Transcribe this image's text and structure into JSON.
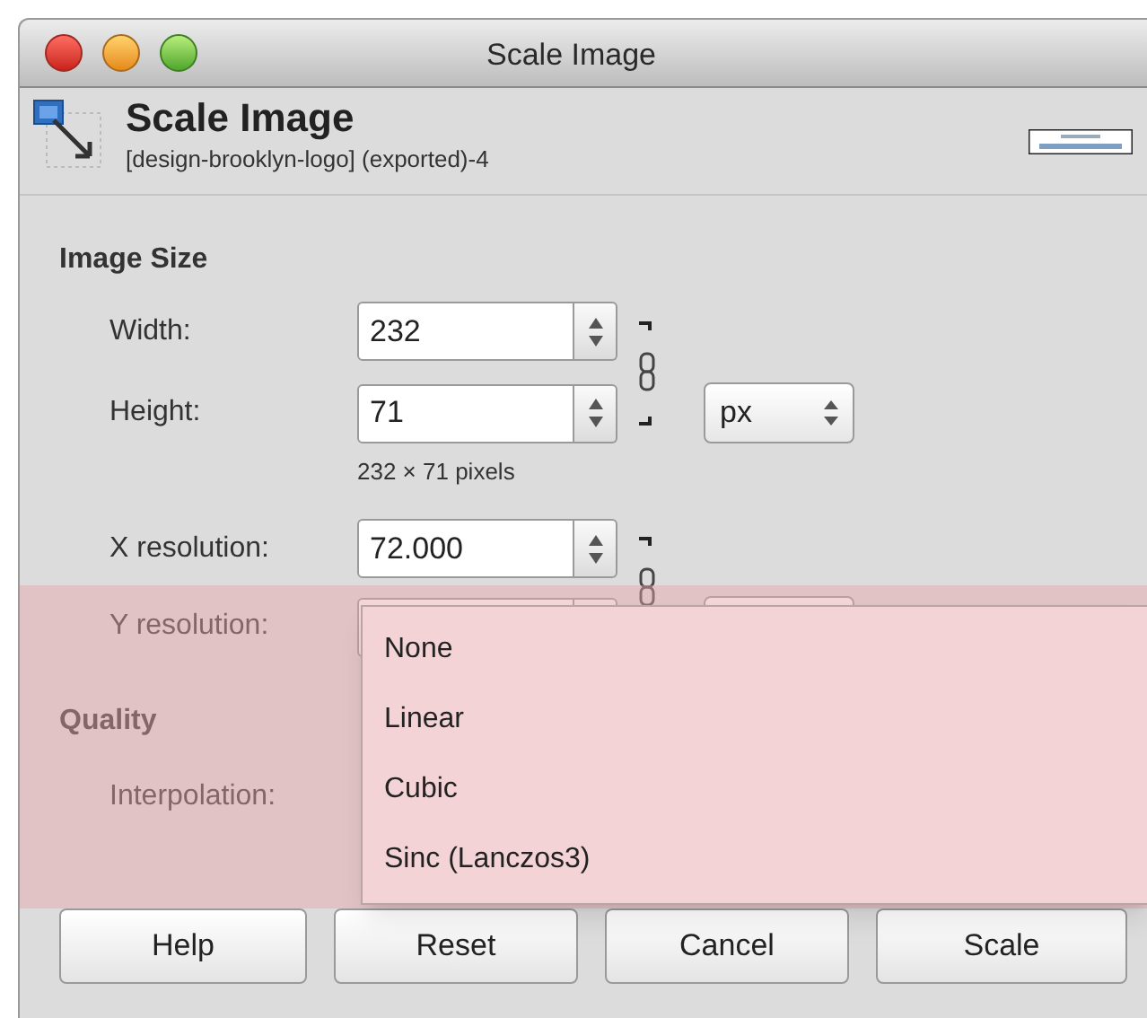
{
  "window": {
    "title": "Scale Image"
  },
  "header": {
    "title": "Scale Image",
    "subtitle": "[design-brooklyn-logo] (exported)-4"
  },
  "image_size": {
    "heading": "Image Size",
    "fields": [
      {
        "label": "Width:",
        "value": "232"
      },
      {
        "label": "Height:",
        "value": "71"
      }
    ],
    "unit": "px",
    "pixel_size": "232 × 71 pixels",
    "resolution_fields": [
      {
        "label": "X resolution:",
        "value": "72.000"
      },
      {
        "label": "Y resolution:"
      }
    ]
  },
  "quality": {
    "heading": "Quality",
    "interpolation_label": "Interpolation:",
    "highlighted": true
  },
  "interpolation_menu": {
    "items": [
      "None",
      "Linear",
      "Cubic",
      "Sinc (Lanczos3)"
    ]
  },
  "buttons": [
    "Help",
    "Reset",
    "Cancel",
    "Scale"
  ]
}
